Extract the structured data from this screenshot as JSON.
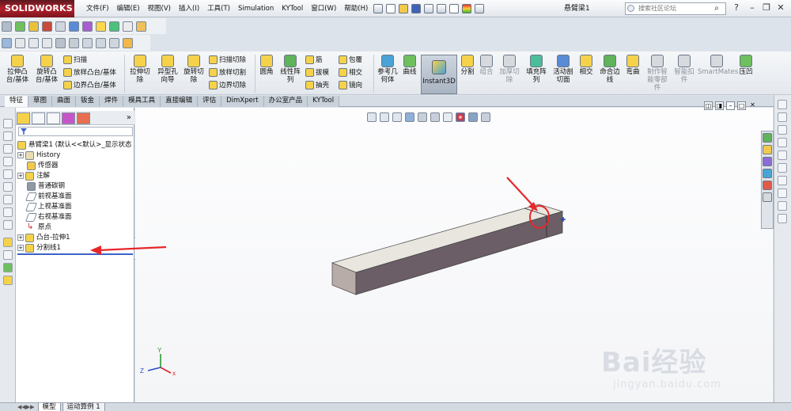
{
  "app": {
    "logo": "SOLIDWORKS",
    "document_title": "悬臂梁1"
  },
  "menu": [
    "文件(F)",
    "编辑(E)",
    "视图(V)",
    "插入(I)",
    "工具(T)",
    "Simulation",
    "KYTool",
    "窗口(W)",
    "帮助(H)"
  ],
  "search": {
    "placeholder": "搜索社区论坛"
  },
  "window_buttons": {
    "help": "?",
    "minimize": "–",
    "restore": "❐",
    "close": "✕"
  },
  "commands": {
    "extrude_boss": "拉伸凸\n台/基体",
    "revolve_boss": "旋转凸\n台/基体",
    "sweep": "扫描",
    "loft_boss": "放样凸台/基体",
    "boundary_boss": "边界凸台/基体",
    "extrude_cut": "拉伸切\n除",
    "hole_wizard": "异型孔\n向导",
    "revolve_cut": "旋转切\n除",
    "swept_cut": "扫描切除",
    "lofted_cut": "放样切割",
    "boundary_cut": "边界切除",
    "fillet": "圆角",
    "linear_pattern": "线性阵\n列",
    "rib": "筋",
    "draft": "拔模",
    "shell": "抽壳",
    "wrap": "包覆",
    "intersect": "相交",
    "mirror": "镜向",
    "ref_geometry": "参考几\n何体",
    "curves": "曲线",
    "instant3d": "Instant3D",
    "split": "分割",
    "combine": "组合",
    "thicken_cut": "加厚切\n除",
    "fill_pattern": "填充阵\n列",
    "move_face": "活动剖\n切面",
    "intersect2": "相交",
    "bend_edge": "命合边\n线",
    "flex": "弯曲",
    "make_smart": "制作智\n能零部\n件",
    "smart_fastener": "智能扣\n件",
    "smartmates": "SmartMates",
    "indent": "压凹"
  },
  "tabs": [
    "特征",
    "草图",
    "曲面",
    "钣金",
    "焊件",
    "模具工具",
    "直接编辑",
    "评估",
    "DimXpert",
    "办公室产品",
    "KYTool"
  ],
  "tree": {
    "root": "悬臂梁1 (默认<<默认>_显示状态",
    "items": [
      "History",
      "传感器",
      "注解",
      "普通碳钢",
      "前视基准面",
      "上视基准面",
      "右视基准面",
      "原点",
      "凸台-拉伸1",
      "分割线1"
    ]
  },
  "triad": {
    "x": "x",
    "y": "Y",
    "z": "Z"
  },
  "bottom_tabs": [
    "模型",
    "运动算例 1"
  ],
  "watermark": {
    "brand": "Bai经验",
    "url": "jingyan.baidu.com"
  },
  "colors": {
    "annotation_red": "#e8262a",
    "logo_red": "#b3202c",
    "beam_top": "#e9e6df",
    "beam_front": "#6b5e66",
    "beam_end": "#b8aca9",
    "selection": "#3d63c8"
  },
  "icons": [
    "search-icon",
    "new-doc-icon",
    "open-icon",
    "save-icon",
    "print-icon",
    "undo-icon",
    "select-icon",
    "rebuild-icon",
    "options-icon",
    "filter-icon",
    "zoom-fit-icon",
    "zoom-area-icon",
    "section-view-icon",
    "view-orientation-icon",
    "display-style-icon",
    "appearance-icon",
    "scene-icon"
  ]
}
